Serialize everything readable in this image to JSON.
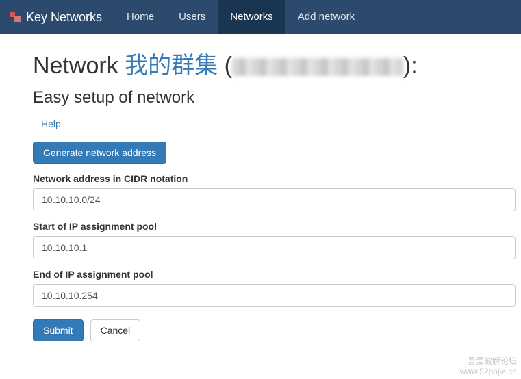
{
  "navbar": {
    "brand": "Key Networks",
    "items": [
      {
        "label": "Home",
        "active": false
      },
      {
        "label": "Users",
        "active": false
      },
      {
        "label": "Networks",
        "active": true
      },
      {
        "label": "Add network",
        "active": false
      }
    ]
  },
  "page": {
    "title_prefix": "Network ",
    "title_link": "我的群集",
    "title_open": " (",
    "title_close": "):",
    "subtitle": "Easy setup of network",
    "help_label": "Help"
  },
  "actions": {
    "generate_label": "Generate network address",
    "submit_label": "Submit",
    "cancel_label": "Cancel"
  },
  "form": {
    "cidr": {
      "label": "Network address in CIDR notation",
      "value": "10.10.10.0/24"
    },
    "pool_start": {
      "label": "Start of IP assignment pool",
      "value": "10.10.10.1"
    },
    "pool_end": {
      "label": "End of IP assignment pool",
      "value": "10.10.10.254"
    }
  },
  "watermark": {
    "line1": "吾爱破解论坛",
    "line2": "www.52pojie.cn"
  },
  "colors": {
    "navbar_bg": "#2b4a6d",
    "navbar_active_bg": "#1a3552",
    "primary": "#337ab7",
    "link": "#337ab7"
  }
}
